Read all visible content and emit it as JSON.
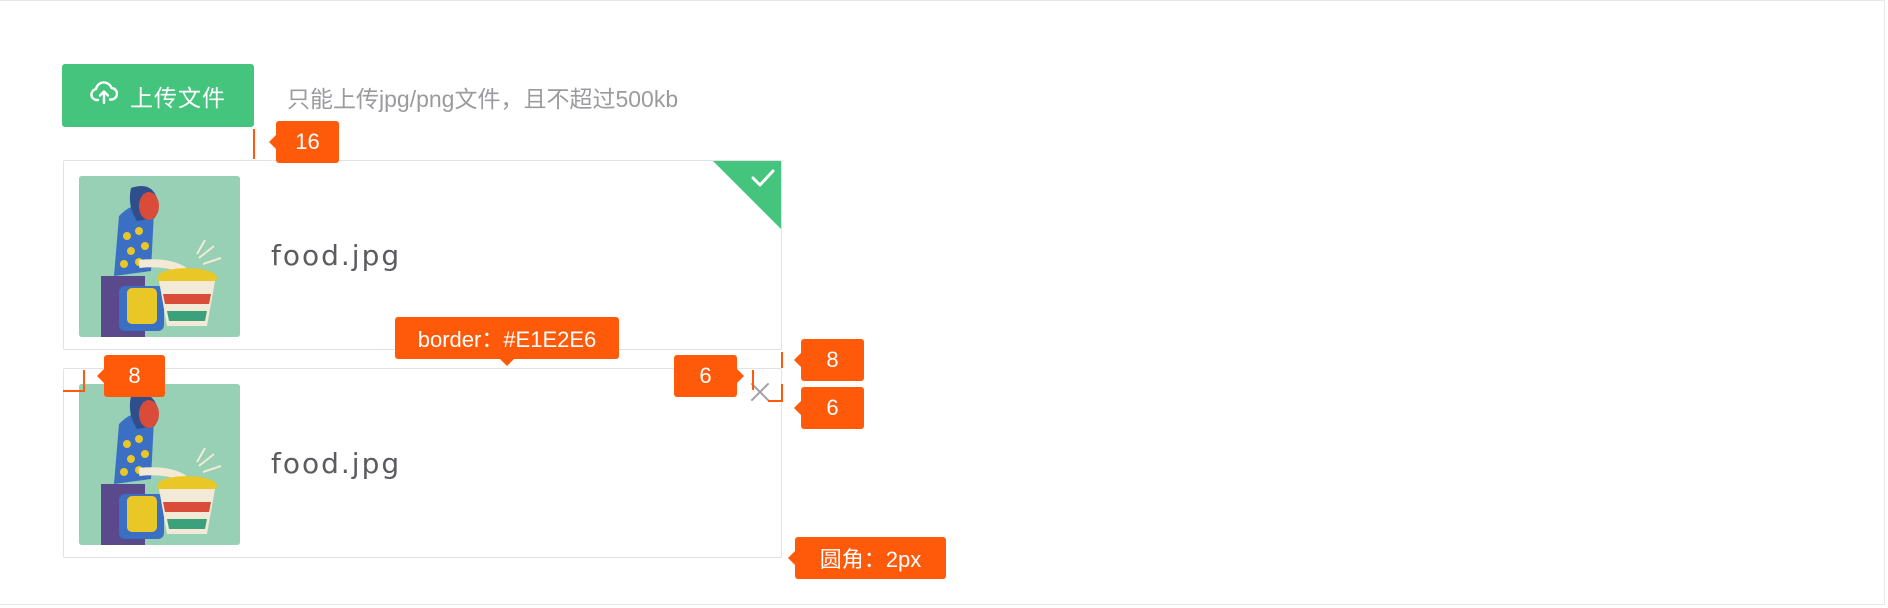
{
  "upload": {
    "button_label": "上传文件",
    "hint": "只能上传jpg/png文件，且不超过500kb"
  },
  "files": [
    {
      "name": "food.jpg",
      "status": "success"
    },
    {
      "name": "food.jpg",
      "status": "default"
    }
  ],
  "annotations": {
    "gap_16": "16",
    "padding_8": "8",
    "border_color": "border：#E1E2E6",
    "offset_6_a": "6",
    "offset_8": "8",
    "offset_6_b": "6",
    "radius": "圆角：2px"
  },
  "colors": {
    "primary": "#45C47E",
    "annotation": "#FF5A0A",
    "border": "#E1E2E6",
    "hint_text": "#9B9B9F"
  },
  "icons": {
    "upload": "upload-cloud-icon",
    "success": "check-icon",
    "remove": "close-icon"
  }
}
